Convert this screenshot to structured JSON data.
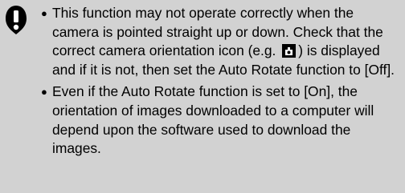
{
  "note": {
    "icon": "caution-icon",
    "items": [
      {
        "bullet": "●",
        "text_before_icon": "This function may not operate correctly when the camera is pointed straight up or down. Check that the correct camera orientation icon (e.g.",
        "inline_icon": "camera-orientation-icon",
        "text_after_icon": ") is displayed and if it is not, then set the Auto Rotate function to [Off]."
      },
      {
        "bullet": "●",
        "text": "Even if the Auto Rotate function is set to [On], the orientation of images downloaded to a computer will depend upon the software used to download the images."
      }
    ]
  }
}
